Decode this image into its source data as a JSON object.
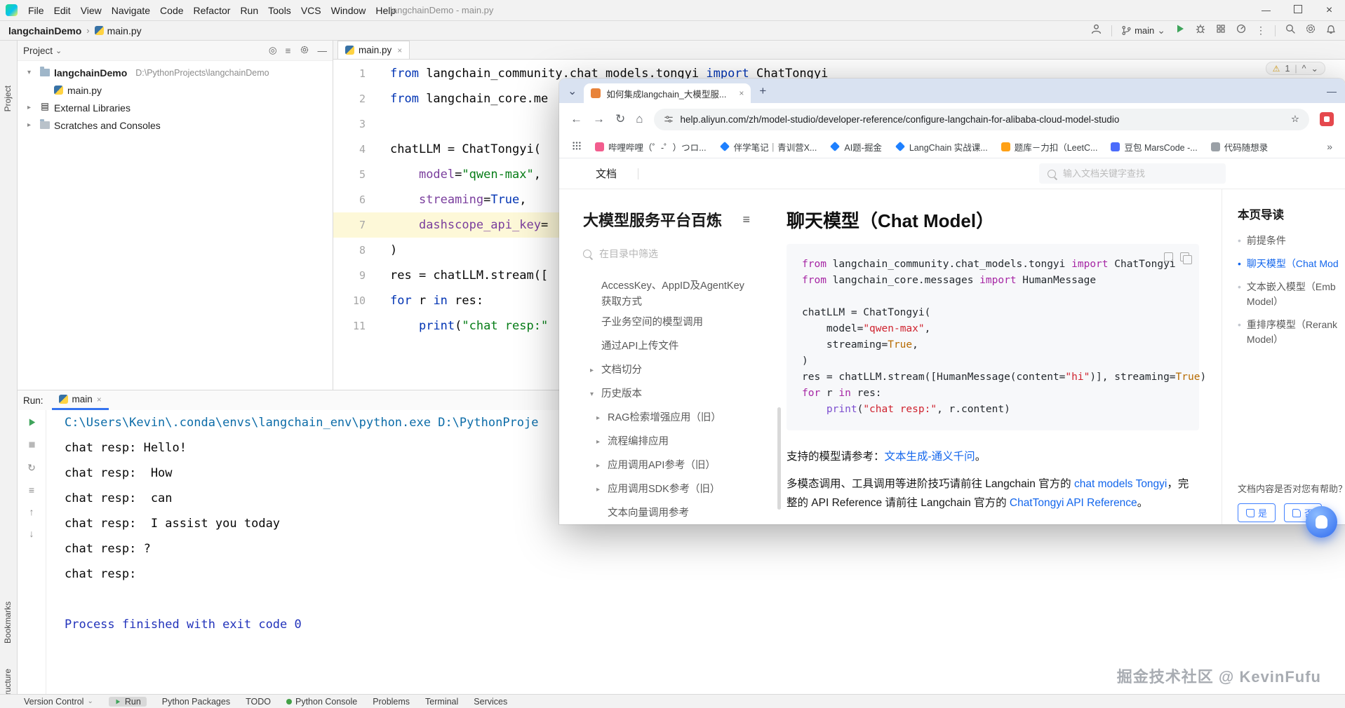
{
  "glyphs": {
    "min": "—",
    "close": "×",
    "chev_d": "⌄",
    "chev_u": "^",
    "chev_r": "›",
    "caret_d": "▾",
    "caret_r": "▸",
    "plus": "+",
    "hamburger": "≡",
    "back": "←",
    "fwd": "→",
    "reload": "↻",
    "home": "⌂",
    "star": "☆",
    "more": "⋮",
    "guillemet": "»",
    "warn": "⚠",
    "bullet": "•",
    "cross": "×",
    "up": "↑",
    "down": "↓",
    "stop": "■",
    "target": "◎"
  },
  "ide": {
    "menu": [
      "File",
      "Edit",
      "View",
      "Navigate",
      "Code",
      "Refactor",
      "Run",
      "Tools",
      "VCS",
      "Window",
      "Help"
    ],
    "window_title": "langchainDemo - main.py",
    "breadcrumb": {
      "project": "langchainDemo",
      "file": "main.py"
    },
    "branch": "main",
    "stripe": {
      "project": "Project",
      "bookmarks": "Bookmarks",
      "structure": "Structure"
    },
    "project_panel": {
      "title": "Project",
      "root_name": "langchainDemo",
      "root_path": "D:\\PythonProjects\\langchainDemo",
      "file": "main.py",
      "lib": "External Libraries",
      "scratches": "Scratches and Consoles"
    },
    "editor": {
      "tab": "main.py",
      "inspections": "1",
      "code": [
        {
          "n": "1",
          "tok": [
            [
              "from",
              "k"
            ],
            [
              " langchain_community.chat_models.tongyi ",
              "t"
            ],
            [
              "import",
              "k"
            ],
            [
              " ChatTongyi",
              "t"
            ]
          ]
        },
        {
          "n": "2",
          "tok": [
            [
              "from",
              "k"
            ],
            [
              " langchain_core.me",
              "t"
            ]
          ]
        },
        {
          "n": "3",
          "tok": []
        },
        {
          "n": "4",
          "tok": [
            [
              "chatLLM = ChatTongyi(",
              "t"
            ]
          ]
        },
        {
          "n": "5",
          "tok": [
            [
              "    ",
              "t"
            ],
            [
              "model",
              "p"
            ],
            [
              "=",
              "t"
            ],
            [
              "\"qwen-max\"",
              "s"
            ],
            [
              ",",
              "t"
            ]
          ]
        },
        {
          "n": "6",
          "tok": [
            [
              "    ",
              "t"
            ],
            [
              "streaming",
              "p"
            ],
            [
              "=",
              "t"
            ],
            [
              "True",
              "k"
            ],
            [
              ",",
              "t"
            ]
          ]
        },
        {
          "n": "7",
          "hl": true,
          "tok": [
            [
              "    ",
              "t"
            ],
            [
              "dashscope_api_key",
              "p"
            ],
            [
              "=",
              "t"
            ]
          ]
        },
        {
          "n": "8",
          "tok": [
            [
              ")",
              "t"
            ]
          ]
        },
        {
          "n": "9",
          "tok": [
            [
              "res = chatLLM.stream([",
              "t"
            ]
          ]
        },
        {
          "n": "10",
          "tok": [
            [
              "for",
              "k"
            ],
            [
              " r ",
              "t"
            ],
            [
              "in",
              "k"
            ],
            [
              " res:",
              "t"
            ]
          ]
        },
        {
          "n": "11",
          "tok": [
            [
              "    ",
              "t"
            ],
            [
              "print",
              "b"
            ],
            [
              "(",
              "t"
            ],
            [
              "\"chat resp:\"",
              "s"
            ]
          ]
        }
      ]
    },
    "run": {
      "label": "Run:",
      "tab": "main",
      "console": [
        {
          "c": "cmd",
          "text": "C:\\Users\\Kevin\\.conda\\envs\\langchain_env\\python.exe D:\\PythonProje"
        },
        {
          "c": "out",
          "text": "chat resp: Hello!"
        },
        {
          "c": "out",
          "text": "chat resp:  How"
        },
        {
          "c": "out",
          "text": "chat resp:  can"
        },
        {
          "c": "out",
          "text": "chat resp:  I assist you today"
        },
        {
          "c": "out",
          "text": "chat resp: ?"
        },
        {
          "c": "out",
          "text": "chat resp:"
        },
        {
          "c": "out",
          "text": ""
        },
        {
          "c": "sys",
          "text": "Process finished with exit code 0"
        }
      ]
    },
    "statusbar": [
      "Version Control",
      "Run",
      "Python Packages",
      "TODO",
      "Python Console",
      "Problems",
      "Terminal",
      "Services"
    ]
  },
  "browser": {
    "tab_title": "如何集成langchain_大模型服...",
    "url": "help.aliyun.com/zh/model-studio/developer-reference/configure-langchain-for-alibaba-cloud-model-studio",
    "bookmarks": [
      {
        "label": "哔哩哔哩（゜-゜）つロ...",
        "color": "#f25d8e",
        "shape": "square"
      },
      {
        "label": "伴学笔记｜青训营X...",
        "color": "#1e80ff",
        "shape": "diamond"
      },
      {
        "label": "AI题-掘金",
        "color": "#1e80ff",
        "shape": "diamond"
      },
      {
        "label": "LangChain 实战课...",
        "color": "#1e80ff",
        "shape": "diamond"
      },
      {
        "label": "题库－力扣（LeetC...",
        "color": "#ffa116",
        "shape": "square"
      },
      {
        "label": "豆包 MarsCode -...",
        "color": "#4b6bfb",
        "shape": "square"
      },
      {
        "label": "代码随想录",
        "color": "#9aa0a6",
        "shape": "square"
      }
    ],
    "doc_nav": "文档",
    "search_placeholder": "输入文档关键字查找",
    "sidebar": {
      "title": "大模型服务平台百炼",
      "filter_placeholder": "在目录中筛选",
      "items": [
        {
          "label": "AccessKey、AppID及AgentKey获取方式",
          "caret": "",
          "level": 1
        },
        {
          "label": "子业务空间的模型调用",
          "caret": "",
          "level": 1
        },
        {
          "label": "通过API上传文件",
          "caret": "",
          "level": 1
        },
        {
          "label": "文档切分",
          "caret": "right",
          "level": 1
        },
        {
          "label": "历史版本",
          "caret": "down",
          "level": 1
        },
        {
          "label": "RAG检索增强应用（旧）",
          "caret": "right",
          "level": 2
        },
        {
          "label": "流程编排应用",
          "caret": "right",
          "level": 2
        },
        {
          "label": "应用调用API参考（旧）",
          "caret": "right",
          "level": 2
        },
        {
          "label": "应用调用SDK参考（旧）",
          "caret": "right",
          "level": 2
        },
        {
          "label": "文本向量调用参考",
          "caret": "",
          "level": 2
        }
      ]
    },
    "article": {
      "title": "聊天模型（Chat Model）",
      "code": [
        {
          "tok": [
            [
              "from",
              "k"
            ],
            [
              " langchain_community.chat_models.tongyi ",
              "t"
            ],
            [
              "import",
              "k"
            ],
            [
              " ChatTongyi",
              "t"
            ]
          ]
        },
        {
          "tok": [
            [
              "from",
              "k"
            ],
            [
              " langchain_core.messages ",
              "t"
            ],
            [
              "import",
              "k"
            ],
            [
              " HumanMessage",
              "t"
            ]
          ]
        },
        {
          "tok": []
        },
        {
          "tok": [
            [
              "chatLLM = ChatTongyi(",
              "t"
            ]
          ]
        },
        {
          "tok": [
            [
              "    model=",
              "t"
            ],
            [
              "\"qwen-max\"",
              "s"
            ],
            [
              ",",
              "t"
            ]
          ]
        },
        {
          "tok": [
            [
              "    streaming=",
              "t"
            ],
            [
              "True",
              "b"
            ],
            [
              ",",
              "t"
            ]
          ]
        },
        {
          "tok": [
            [
              ")",
              "t"
            ]
          ]
        },
        {
          "tok": [
            [
              "res = chatLLM.stream([HumanMessage(content=",
              "t"
            ],
            [
              "\"hi\"",
              "s"
            ],
            [
              ")], streaming=",
              "t"
            ],
            [
              "True",
              "b"
            ],
            [
              ")",
              "t"
            ]
          ]
        },
        {
          "tok": [
            [
              "for",
              "k"
            ],
            [
              " r ",
              "t"
            ],
            [
              "in",
              "k"
            ],
            [
              " res:",
              "t"
            ]
          ]
        },
        {
          "tok": [
            [
              "    ",
              "t"
            ],
            [
              "print",
              "f"
            ],
            [
              "(",
              "t"
            ],
            [
              "\"chat resp:\"",
              "s"
            ],
            [
              ", r.content)",
              "t"
            ]
          ]
        }
      ],
      "para1": [
        {
          "t": "支持的模型请参考："
        },
        {
          "t": "文本生成-通义千问",
          "link": true
        },
        {
          "t": "。"
        }
      ],
      "para2": [
        {
          "t": "多模态调用、工具调用等进阶技巧请前往 Langchain 官方的 "
        },
        {
          "t": "chat models Tongyi",
          "link": true
        },
        {
          "t": "，完整的 API Reference 请前往 Langchain 官方的 "
        },
        {
          "t": "ChatTongyi API Reference",
          "link": true
        },
        {
          "t": "。"
        }
      ]
    },
    "toc": {
      "title": "本页导读",
      "items": [
        {
          "lines": [
            "前提条件"
          ]
        },
        {
          "lines": [
            "聊天模型（Chat Mod"
          ],
          "active": true
        },
        {
          "lines": [
            "文本嵌入模型（Emb",
            "Model）"
          ]
        },
        {
          "lines": [
            "重排序模型（Rerank",
            "Model）"
          ]
        }
      ],
      "feedback": {
        "q": "文档内容是否对您有帮助？",
        "yes": "是",
        "no": "否"
      }
    }
  },
  "watermark": "掘金技术社区 @ KevinFufu"
}
